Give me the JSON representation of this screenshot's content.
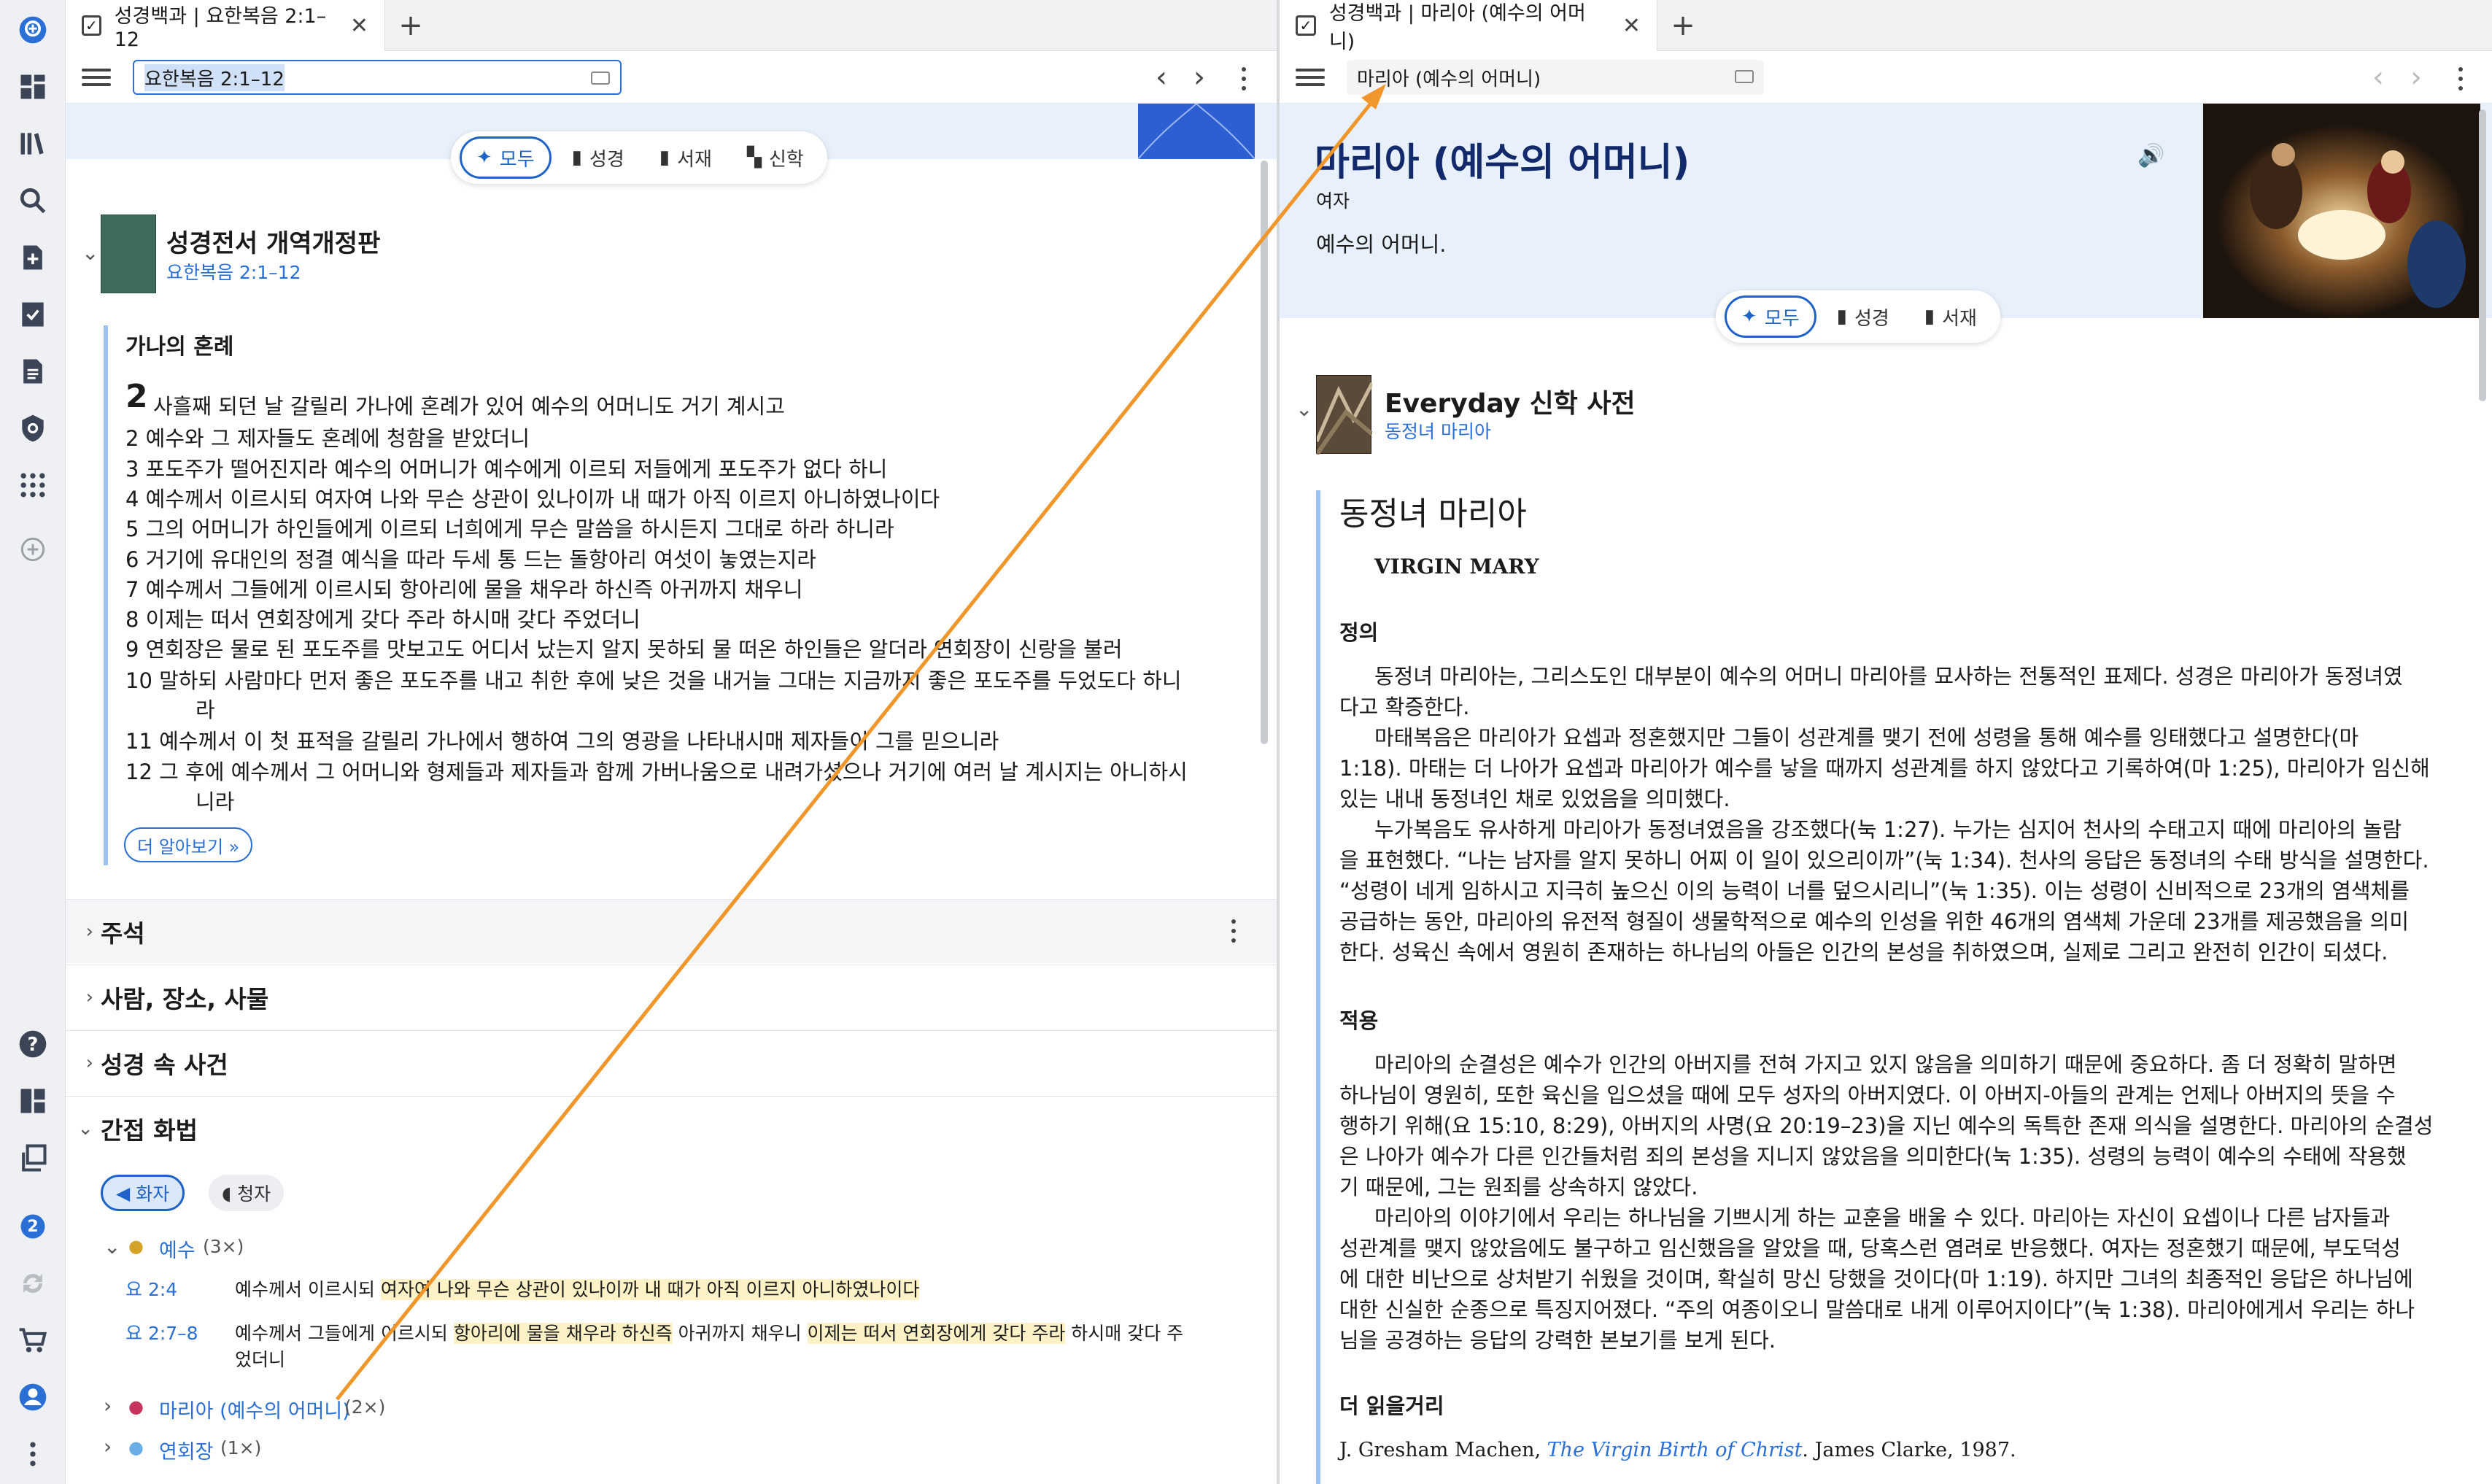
{
  "left": {
    "tab_title": "성경백과 | 요한복음 2:1–12",
    "address": "요한복음 2:1–12",
    "filters": [
      "모두",
      "성경",
      "서재",
      "신학"
    ],
    "resource": {
      "title": "성경전서 개역개정판",
      "reference": "요한복음 2:1–12"
    },
    "passage_heading": "가나의 혼례",
    "chapter_number": "2",
    "verses": [
      "사흘째 되던 날 갈릴리 가나에 혼례가 있어 예수의 어머니도 거기 계시고",
      "2 예수와 그 제자들도 혼례에 청함을 받았더니",
      "3 포도주가 떨어진지라 예수의 어머니가 예수에게 이르되 저들에게 포도주가 없다 하니",
      "4 예수께서 이르시되 여자여 나와 무슨 상관이 있나이까 내 때가 아직 이르지 아니하였나이다",
      "5 그의 어머니가 하인들에게 이르되 너희에게 무슨 말씀을 하시든지 그대로 하라 하니라",
      "6 거기에 유대인의 정결 예식을 따라 두세 통 드는 돌항아리 여섯이 놓였는지라",
      "7 예수께서 그들에게 이르시되 항아리에 물을 채우라 하신즉 아귀까지 채우니",
      "8 이제는 떠서 연회장에게 갖다 주라 하시매 갖다 주었더니",
      "9 연회장은 물로 된 포도주를 맛보고도 어디서 났는지 알지 못하되 물 떠온 하인들은 알더라 연회장이 신랑을 불러",
      "10 말하되 사람마다 먼저 좋은 포도주를 내고 취한 후에 낮은 것을 내거늘 그대는 지금까지 좋은 포도주를 두었도다 하니",
      "라",
      "11 예수께서 이 첫 표적을 갈릴리 가나에서 행하여 그의 영광을 나타내시매 제자들이 그를 믿으니라",
      "12 그 후에 예수께서 그 어머니와 형제들과 제자들과 함께 가버나움으로 내려가셨으나 거기에 여러 날 계시지는 아니하시",
      "니라"
    ],
    "more_button": "더 알아보기 »",
    "sections": [
      "주석",
      "사람, 장소, 사물",
      "성경 속 사건",
      "간접 화법"
    ],
    "speech_tabs": [
      "화자",
      "청자"
    ],
    "speakers": [
      {
        "name": "예수",
        "count": "(3×)"
      },
      {
        "name": "마리아 (예수의 어머니)",
        "count": "(2×)"
      },
      {
        "name": "연회장",
        "count": "(1×)"
      }
    ],
    "quotes": [
      {
        "ref": "요 2:4",
        "pre": "예수께서 이르시되 ",
        "hl": "여자여 나와 무슨 상관이 있나이까 내 때가 아직 이르지 아니하였나이다"
      },
      {
        "ref": "요 2:7–8",
        "pre": "예수께서 그들에게 이르시되 ",
        "hl": "항아리에 물을 채우라 하신즉",
        "mid": " 아귀까지 채우니 ",
        "hl2": "이제는 떠서 연회장에게 갖다 주라",
        "post": " 하시매 갖다 주",
        "cont": "었더니"
      }
    ]
  },
  "right": {
    "tab_title": "성경백과 | 마리아 (예수의 어머니)",
    "address": "마리아 (예수의 어머니)",
    "entry_title": "마리아 (예수의 어머니)",
    "entry_gender": "여자",
    "entry_desc": "예수의 어머니.",
    "filters": [
      "모두",
      "성경",
      "서재"
    ],
    "resource": {
      "title": "Everyday 신학 사전",
      "subtitle": "동정녀 마리아"
    },
    "article_title": "동정녀 마리아",
    "article_en": "VIRGIN MARY",
    "h_def": "정의",
    "def_lines": [
      "동정녀 마리아는, 그리스도인 대부분이 예수의 어머니 마리아를 묘사하는 전통적인 표제다. 성경은 마리아가 동정녀였",
      "다고 확증한다.",
      "마태복음은 마리아가 요셉과 정혼했지만 그들이 성관계를 맺기 전에 성령을 통해 예수를 잉태했다고 설명한다(마",
      "1:18). 마태는 더 나아가 요셉과 마리아가 예수를 낳을 때까지 성관계를 하지 않았다고 기록하여(마 1:25), 마리아가 임신해",
      "있는 내내 동정녀인 채로 있었음을 의미했다.",
      "누가복음도 유사하게 마리아가 동정녀였음을 강조했다(눅 1:27). 누가는 심지어 천사의 수태고지 때에 마리아의 놀람",
      "을 표현했다. “나는 남자를 알지 못하니 어찌 이 일이 있으리이까”(눅 1:34). 천사의 응답은 동정녀의 수태 방식을 설명한다.",
      "“성령이 네게 임하시고 지극히 높으신 이의 능력이 너를 덮으시리니”(눅 1:35). 이는 성령이 신비적으로 23개의 염색체를",
      "공급하는 동안, 마리아의 유전적 형질이 생물학적으로 예수의 인성을 위한 46개의 염색체 가운데 23개를 제공했음을 의미",
      "한다. 성육신 속에서 영원히 존재하는 하나님의 아들은 인간의 본성을 취하였으며, 실제로 그리고 완전히 인간이 되셨다."
    ],
    "h_app": "적용",
    "app_lines": [
      "마리아의 순결성은 예수가 인간의 아버지를 전혀 가지고 있지 않음을 의미하기 때문에 중요하다. 좀 더 정확히 말하면",
      "하나님이 영원히, 또한 육신을 입으셨을 때에 모두 성자의 아버지였다. 이 아버지-아들의 관계는 언제나 아버지의 뜻을 수",
      "행하기 위해(요 15:10, 8:29), 아버지의 사명(요 20:19–23)을 지닌 예수의 독특한 존재 의식을 설명한다. 마리아의 순결성",
      "은 나아가 예수가 다른 인간들처럼 죄의 본성을 지니지 않았음을 의미한다(눅 1:35). 성령의 능력이 예수의 수태에 작용했",
      "기 때문에, 그는 원죄를 상속하지 않았다.",
      "마리아의 이야기에서 우리는 하나님을 기쁘시게 하는 교훈을 배울 수 있다. 마리아는 자신이 요셉이나 다른 남자들과",
      "성관계를 맺지 않았음에도 불구하고 임신했음을 알았을 때, 당혹스런 염려로 반응했다. 여자는 정혼했기 때문에, 부도덕성",
      "에 대한 비난으로 상처받기 쉬웠을 것이며, 확실히 망신 당했을 것이다(마 1:19). 하지만 그녀의 최종적인 응답은 하나님에",
      "대한 신실한 순종으로 특징지어졌다. “주의 여종이오니 말씀대로 내게 이루어지이다”(눅 1:38). 마리아에게서 우리는 하나",
      "님을 공경하는 응답의 강력한 본보기를 보게 된다."
    ],
    "h_read": "더 읽을거리",
    "read_author": "J. Gresham Machen, ",
    "read_book": "The Virgin Birth of Christ",
    "read_pub": ". James Clarke, 1987."
  },
  "rail": {
    "badge": "2"
  },
  "colors": {
    "accent": "#1f63c8",
    "link": "#2a6fd6",
    "highlight": "#fdf1c6",
    "arrow": "#f0962a",
    "band": "#e8f1fb"
  },
  "icons": [
    "logos-icon",
    "dashboard-icon",
    "library-icon",
    "search-icon",
    "add-doc-icon",
    "checklist-icon",
    "document-icon",
    "shield-icon",
    "apps-icon",
    "add-circle-icon",
    "help-icon",
    "layout-icon",
    "copy-icon",
    "sync-icon",
    "cart-icon",
    "user-icon",
    "more-icon"
  ]
}
